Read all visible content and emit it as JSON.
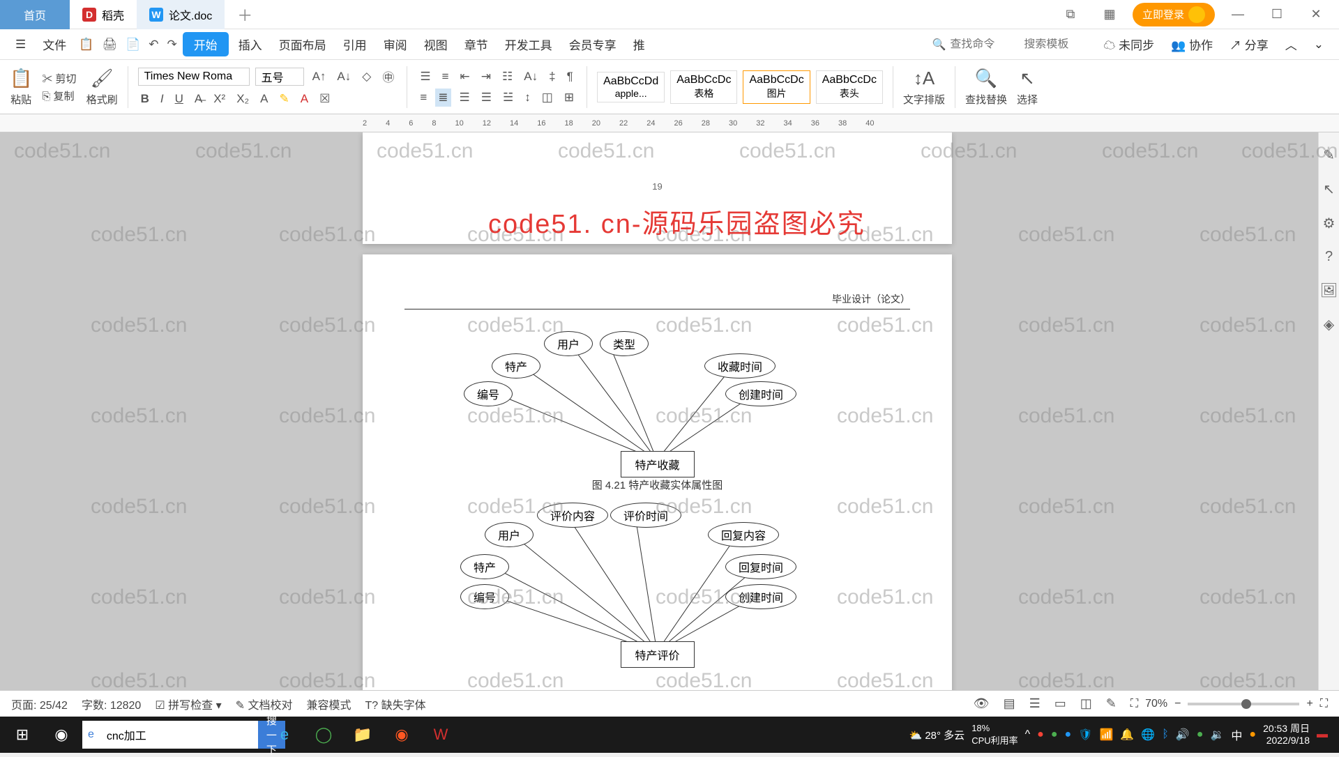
{
  "titlebar": {
    "home": "首页",
    "tab_docer": "稻壳",
    "tab_doc": "论文.doc",
    "login": "立即登录"
  },
  "menu": {
    "file": "文件",
    "items": [
      "开始",
      "插入",
      "页面布局",
      "引用",
      "审阅",
      "视图",
      "章节",
      "开发工具",
      "会员专享",
      "推"
    ],
    "search_cmd": "查找命令",
    "search_tpl": "搜索模板",
    "unsync": "未同步",
    "coop": "协作",
    "share": "分享"
  },
  "ribbon": {
    "paste": "粘贴",
    "cut": "剪切",
    "copy": "复制",
    "brush": "格式刷",
    "font": "Times New Roma",
    "size": "五号",
    "styles": [
      {
        "pv": "AaBbCcDd",
        "name": "apple..."
      },
      {
        "pv": "AaBbCcDc",
        "name": "表格"
      },
      {
        "pv": "AaBbCcDc",
        "name": "图片"
      },
      {
        "pv": "AaBbCcDc",
        "name": "表头"
      }
    ],
    "textdir": "文字排版",
    "findrep": "查找替换",
    "select": "选择"
  },
  "doc": {
    "pgnum": "19",
    "header": "毕业设计（论文）",
    "d1": {
      "center": "特产收藏",
      "nodes": [
        "用户",
        "类型",
        "特产",
        "收藏时间",
        "编号",
        "创建时间"
      ],
      "caption": "图 4.21  特产收藏实体属性图"
    },
    "d2": {
      "center": "特产评价",
      "nodes": [
        "评价内容",
        "评价时间",
        "用户",
        "回复内容",
        "特产",
        "回复时间",
        "编号",
        "创建时间"
      ]
    },
    "wm_red": "code51. cn-源码乐园盗图必究",
    "wm": "code51.cn"
  },
  "status": {
    "page": "页面: 25/42",
    "words": "字数: 12820",
    "spell": "拼写检查",
    "proof": "文档校对",
    "compat": "兼容模式",
    "missfont": "缺失字体",
    "zoom": "70%"
  },
  "taskbar": {
    "search": "cnc加工",
    "searchbtn": "搜一下",
    "weather": "28° 多云",
    "cpu": "CPU利用率",
    "pct": "18%",
    "ime": "中",
    "time": "20:53 周日",
    "date": "2022/9/18"
  }
}
